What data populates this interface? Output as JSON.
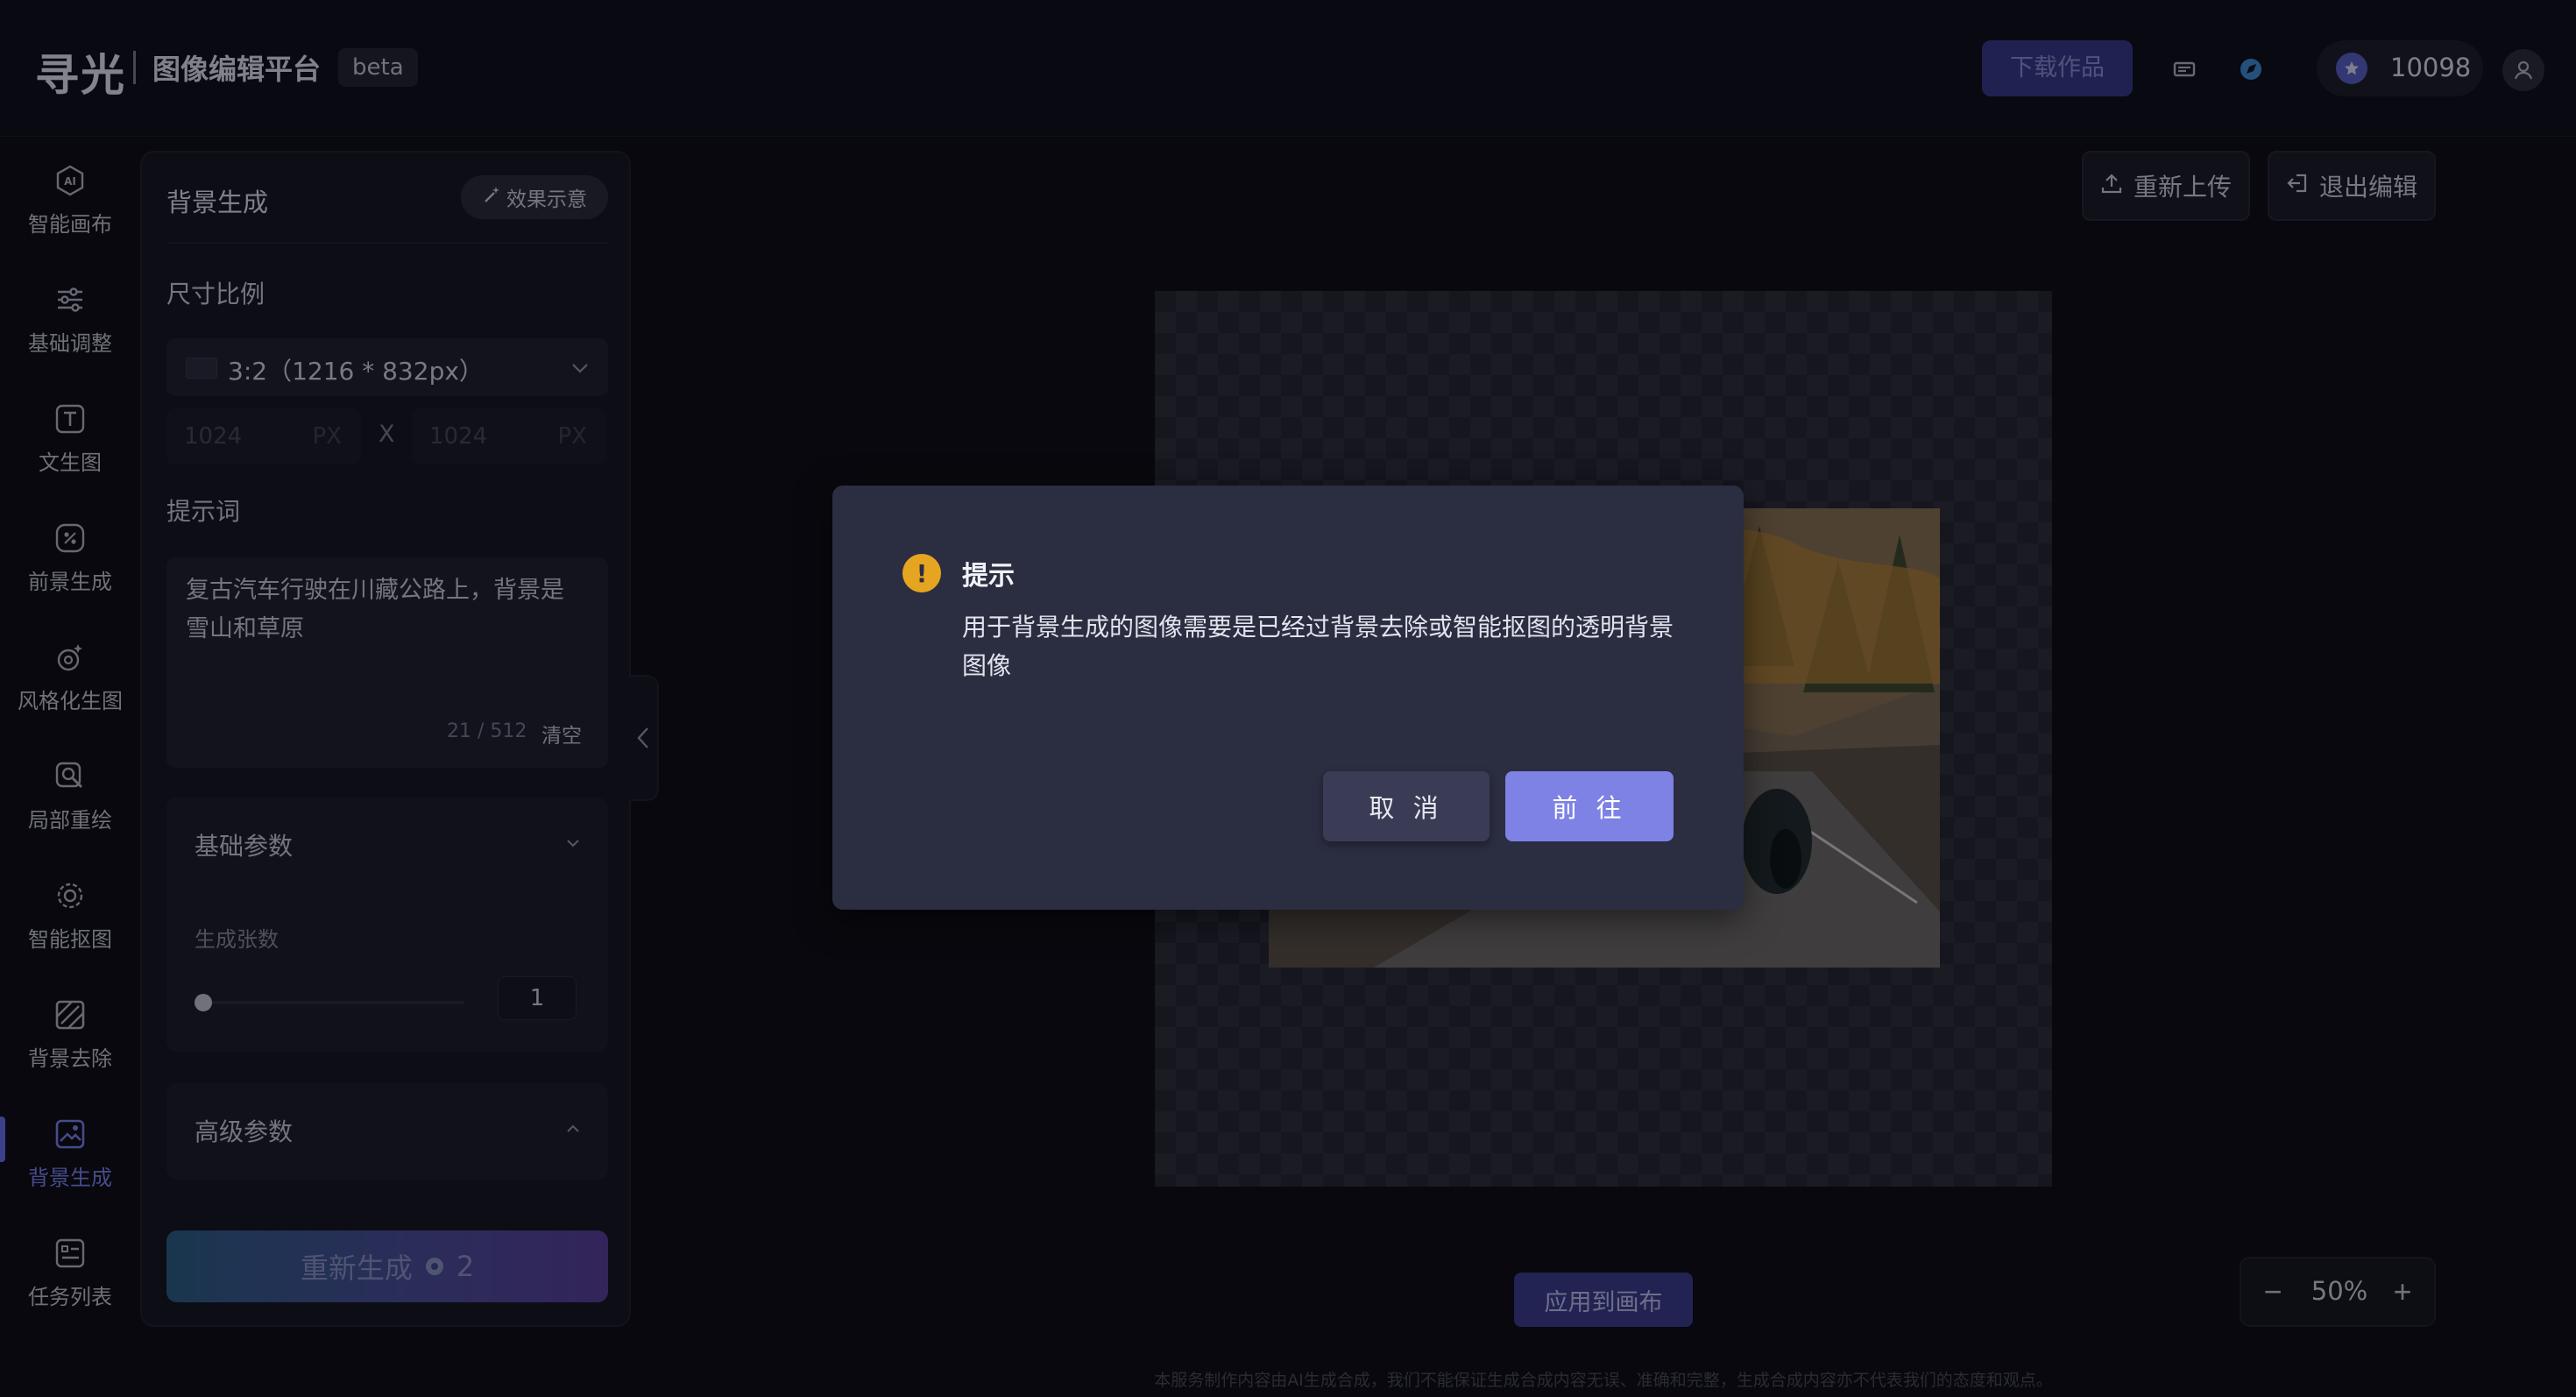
{
  "header": {
    "logo": "寻光",
    "platform_title": "图像编辑平台",
    "beta": "beta",
    "download_label": "下载作品",
    "credits": "10098"
  },
  "nav": {
    "items": [
      {
        "label": "智能画布",
        "icon": "ai-icon"
      },
      {
        "label": "基础调整",
        "icon": "sliders-icon"
      },
      {
        "label": "文生图",
        "icon": "text-icon"
      },
      {
        "label": "前景生成",
        "icon": "foreground-icon"
      },
      {
        "label": "风格化生图",
        "icon": "style-icon"
      },
      {
        "label": "局部重绘",
        "icon": "inpaint-icon"
      },
      {
        "label": "智能抠图",
        "icon": "cutout-icon"
      },
      {
        "label": "背景去除",
        "icon": "bg-remove-icon"
      },
      {
        "label": "背景生成",
        "icon": "bg-generate-icon",
        "active": true
      },
      {
        "label": "任务列表",
        "icon": "task-list-icon"
      }
    ]
  },
  "panel": {
    "title": "背景生成",
    "demo_label": "效果示意",
    "ratio_label": "尺寸比例",
    "ratio_value": "3:2（1216 * 832px）",
    "width_placeholder": "1024",
    "height_placeholder": "1024",
    "unit": "PX",
    "times": "X",
    "prompt_label": "提示词",
    "prompt_text": "复古汽车行驶在川藏公路上，背景是雪山和草原",
    "prompt_count": "21 / 512",
    "clear_label": "清空",
    "basic_params": "基础参数",
    "count_label": "生成张数",
    "count_value": "1",
    "advanced_params": "高级参数",
    "regen_label": "重新生成",
    "regen_cost": "2"
  },
  "canvas": {
    "reupload_label": "重新上传",
    "exit_label": "退出编辑",
    "apply_label": "应用到画布",
    "zoom_value": "50%",
    "disclaimer": "本服务制作内容由AI生成合成，我们不能保证生成合成内容无误、准确和完整，生成合成内容亦不代表我们的态度和观点。"
  },
  "modal": {
    "title": "提示",
    "message": "用于背景生成的图像需要是已经过背景去除或智能抠图的透明背景图像",
    "cancel_label": "取 消",
    "confirm_label": "前 往"
  },
  "colors": {
    "accent": "#7d82e4",
    "warning": "#e6a521",
    "background": "#0b0b12"
  }
}
